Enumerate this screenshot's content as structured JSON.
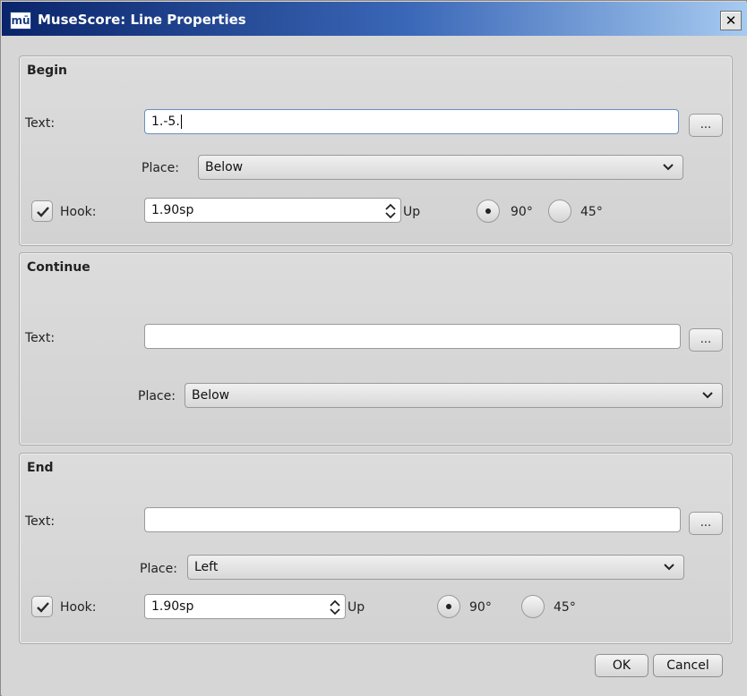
{
  "window": {
    "icon": "musescore-app-icon",
    "icon_text": "mū",
    "title": "MuseScore: Line Properties",
    "close_label": "✕"
  },
  "begin": {
    "title": "Begin",
    "text_label": "Text:",
    "text_value": "1.-5.",
    "dots_label": "...",
    "place_label": "Place:",
    "place_value": "Below",
    "hook_checked": true,
    "hook_label": "Hook:",
    "hook_value": "1.90sp",
    "up_label": "Up",
    "angle_90": "90°",
    "angle_45": "45°",
    "angle_selected": "90°"
  },
  "continue": {
    "title": "Continue",
    "text_label": "Text:",
    "text_value": "",
    "dots_label": "...",
    "place_label": "Place:",
    "place_value": "Below"
  },
  "end": {
    "title": "End",
    "text_label": "Text:",
    "text_value": "",
    "dots_label": "...",
    "place_label": "Place:",
    "place_value": "Left",
    "hook_checked": true,
    "hook_label": "Hook:",
    "hook_value": "1.90sp",
    "up_label": "Up",
    "angle_90": "90°",
    "angle_45": "45°",
    "angle_selected": "90°"
  },
  "buttons": {
    "ok": "OK",
    "cancel": "Cancel"
  }
}
